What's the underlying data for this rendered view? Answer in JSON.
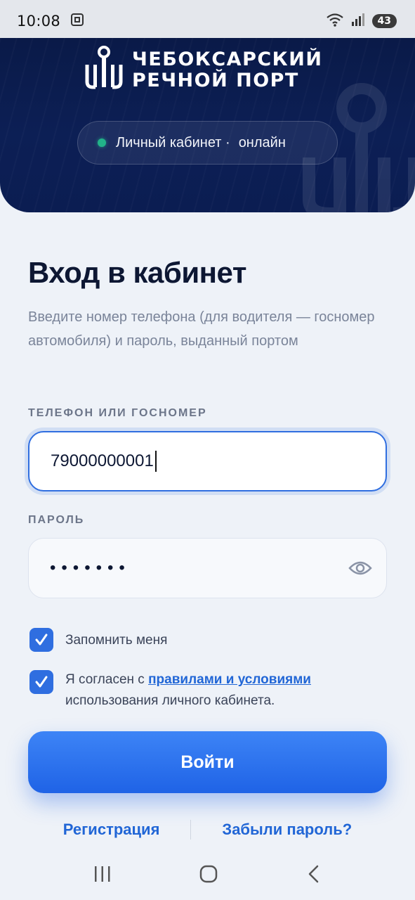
{
  "status_bar": {
    "time": "10:08",
    "battery": "43",
    "icons": [
      "screenshot-icon",
      "wifi-icon",
      "signal-icon",
      "battery-icon"
    ]
  },
  "header": {
    "logo_line1": "ЧЕБОКСАРСКИЙ",
    "logo_line2": "РЕЧНОЙ ПОРТ",
    "pill_label": "Личный кабинет ·",
    "pill_status": "онлайн",
    "status_color": "#22b389"
  },
  "form": {
    "title": "Вход в кабинет",
    "subtitle": "Введите номер телефона (для водителя — госномер автомобиля) и пароль, выданный портом",
    "phone_label": "ТЕЛЕФОН ИЛИ ГОСНОМЕР",
    "phone_value": "79000000001",
    "password_label": "ПАРОЛЬ",
    "password_mask": "•••••••",
    "remember_label": "Запомнить меня",
    "remember_checked": true,
    "agree_prefix": "Я согласен с ",
    "agree_link": "правилами и условиями",
    "agree_suffix": "использования личного кабинета.",
    "agree_checked": true,
    "login_button": "Войти",
    "register_link": "Регистрация",
    "forgot_link": "Забыли пароль?"
  },
  "colors": {
    "accent": "#2f6ee0",
    "header_bg": "#0b1d52",
    "link": "#2166d6"
  }
}
